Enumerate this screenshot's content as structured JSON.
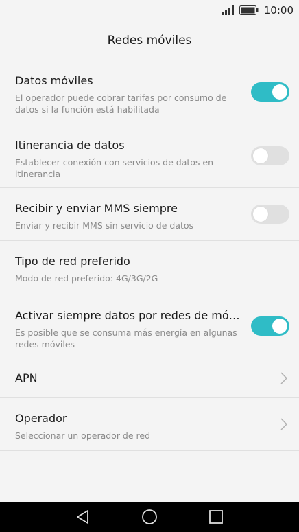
{
  "status": {
    "time": "10:00",
    "icons": [
      "signal-icon",
      "battery-icon"
    ]
  },
  "header": {
    "title": "Redes móviles"
  },
  "settings": [
    {
      "title": "Datos móviles",
      "subtitle": "El operador puede cobrar tarifas por consumo de datos si la función está habilitada",
      "control": "toggle",
      "on": true
    },
    {
      "title": "Itinerancia de datos",
      "subtitle": "Establecer conexión con servicios de datos en itinerancia",
      "control": "toggle",
      "on": false
    },
    {
      "title": "Recibir y enviar MMS siempre",
      "subtitle": "Enviar y recibir MMS sin servicio de datos",
      "control": "toggle",
      "on": false
    },
    {
      "title": "Tipo de red preferido",
      "subtitle": "Modo de red preferido: 4G/3G/2G",
      "control": "none"
    },
    {
      "title": "Activar siempre datos por redes de móvil…",
      "subtitle": "Es posible que se consuma más energía en algunas redes móviles",
      "control": "toggle",
      "on": true
    },
    {
      "title": "APN",
      "control": "chevron"
    },
    {
      "title": "Operador",
      "subtitle": "Seleccionar un operador de red",
      "control": "chevron"
    }
  ],
  "colors": {
    "accent": "#2fbcc6",
    "toggle_off": "#e0e0e0",
    "background": "#f4f4f4"
  },
  "navbar": {
    "icons": [
      "back-icon",
      "home-icon",
      "recents-icon"
    ]
  }
}
